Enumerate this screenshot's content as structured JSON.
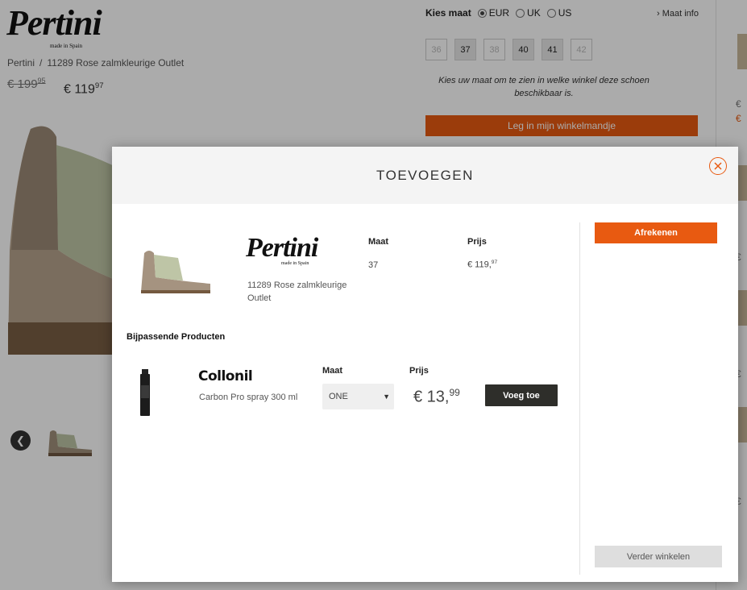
{
  "page": {
    "brand": {
      "name": "Pertini",
      "tagline": "made in Spain"
    },
    "breadcrumb": [
      "Pertini",
      "11289 Rose zalmkleurige Outlet"
    ],
    "price_old": {
      "main": "€ 199",
      "cents": "95"
    },
    "price_new": {
      "main": "€ 119",
      "cents": "97"
    },
    "size_selector": {
      "label": "Kies maat",
      "units": [
        {
          "label": "EUR",
          "selected": true
        },
        {
          "label": "UK",
          "selected": false
        },
        {
          "label": "US",
          "selected": false
        }
      ],
      "info_link": "› Maat info",
      "sizes": [
        "36",
        "37",
        "38",
        "40",
        "41",
        "42"
      ],
      "available": [
        false,
        true,
        false,
        true,
        true,
        false
      ],
      "hint": "Kies uw maat om te zien in welke winkel deze schoen beschikbaar is."
    },
    "cart_button": "Leg in mijn winkelmandje",
    "prev_icon": "chevron-left-icon"
  },
  "colors": {
    "accent": "#e85a11",
    "dark_button": "#2e2e2a",
    "overlay": "rgba(0,0,0,0.33)"
  },
  "modal": {
    "title": "TOEVOEGEN",
    "close_icon": "close-icon",
    "added_item": {
      "brand": "Pertini",
      "brand_tagline": "made in Spain",
      "name": "11289 Rose zalmkleurige Outlet",
      "maat_label": "Maat",
      "maat_value": "37",
      "price_label": "Prijs",
      "price_main": "€ 119,",
      "price_cents": "97"
    },
    "related_title": "Bijpassende Producten",
    "related": [
      {
        "brand": "Collonil",
        "name": "Carbon Pro spray 300 ml",
        "maat_label": "Maat",
        "maat_value": "ONE",
        "price_label": "Prijs",
        "price_main": "€ 13,",
        "price_cents": "99",
        "add_label": "Voeg toe"
      }
    ],
    "checkout_label": "Afrekenen",
    "continue_label": "Verder winkelen"
  }
}
